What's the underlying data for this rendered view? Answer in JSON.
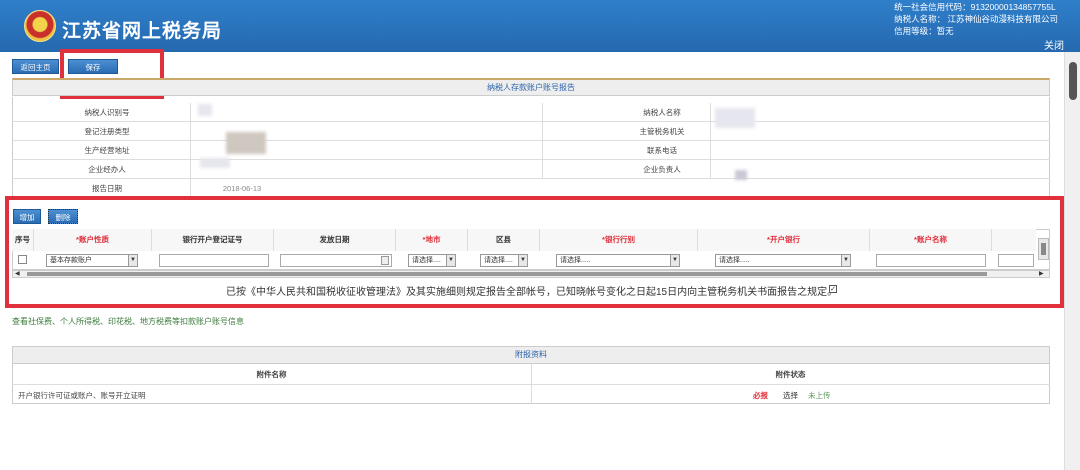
{
  "header": {
    "title": "江苏省网上税务局",
    "credit_code": "统一社会信用代码：91320000134857755L",
    "taxpayer_name": "纳税人名称： 江苏神仙谷动漫科技有限公司",
    "credit_level": "信用等级：暂无",
    "logout_label": "关闭"
  },
  "toolbar": {
    "back_label": "返回主页",
    "save_label": "保存"
  },
  "report": {
    "title": "纳税人存款账户账号报告",
    "rows": [
      {
        "left_label": "纳税人识别号",
        "left_value": "",
        "right_label": "纳税人名称",
        "right_value": ""
      },
      {
        "left_label": "登记注册类型",
        "left_value": "",
        "right_label": "主管税务机关",
        "right_value": ""
      },
      {
        "left_label": "生产经营地址",
        "left_value": "",
        "right_label": "联系电话",
        "right_value": ""
      },
      {
        "left_label": "企业经办人",
        "left_value": "",
        "right_label": "企业负责人",
        "right_value": ""
      },
      {
        "left_label": "报告日期",
        "left_value": "2018-06-13",
        "right_label": "",
        "right_value": ""
      }
    ]
  },
  "accounts": {
    "add_label": "增加",
    "delete_label": "删除",
    "columns": [
      "序号",
      "*账户性质",
      "银行开户登记证号",
      "发放日期",
      "*地市",
      "区县",
      "*银行行别",
      "*开户银行",
      "*账户名称"
    ],
    "row": {
      "account_type": "基本存款账户",
      "city": "请选择....",
      "county": "请选择....",
      "bank_type": "请选择.....",
      "open_bank": "请选择.....",
      "date_icon": "calendar-icon"
    },
    "declaration": "已按《中华人民共和国税收征收管理法》及其实施细则规定报告全部帐号，已知晓帐号变化之日起15日内向主管税务机关书面报告之规定。"
  },
  "other_link": "查看社保费、个人所得税、印花税、地方税费等扣款账户账号信息",
  "attachments": {
    "title": "附报资料",
    "col_name": "附件名称",
    "col_status": "附件状态",
    "rows": [
      {
        "name": "开户银行许可证或账户、账号开立证明",
        "required": "必报",
        "select_label": "选择",
        "status": "未上传"
      }
    ]
  },
  "colors": {
    "header_blue": "#2a6fb8",
    "highlight_red": "#e0303c",
    "required_red": "#e0303c"
  }
}
